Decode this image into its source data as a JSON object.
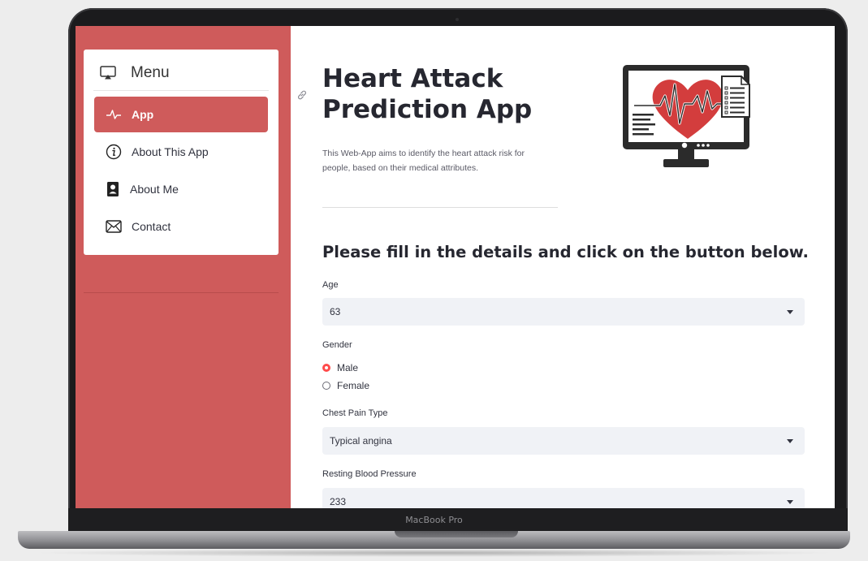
{
  "device": {
    "label": "MacBook Pro"
  },
  "sidebar": {
    "menu_title": "Menu",
    "items": [
      {
        "label": "App",
        "icon": "activity-icon",
        "active": true
      },
      {
        "label": "About This App",
        "icon": "info-icon",
        "active": false
      },
      {
        "label": "About Me",
        "icon": "person-badge-icon",
        "active": false
      },
      {
        "label": "Contact",
        "icon": "envelope-icon",
        "active": false
      }
    ]
  },
  "main": {
    "title": "Heart Attack Prediction App",
    "subtitle": "This Web-App aims to identify the heart attack risk for people, based on their medical attributes.",
    "form_heading": "Please fill in the details and click on the button below.",
    "fields": {
      "age": {
        "label": "Age",
        "value": "63"
      },
      "gender": {
        "label": "Gender",
        "options": [
          "Male",
          "Female"
        ],
        "selected": "Male"
      },
      "chest_pain": {
        "label": "Chest Pain Type",
        "value": "Typical angina"
      },
      "resting_bp": {
        "label": "Resting Blood Pressure",
        "value": "233"
      }
    }
  },
  "colors": {
    "sidebar_bg": "#cf5b5b",
    "accent_red": "#ff4b4b",
    "select_bg": "#f0f2f6",
    "heart_red": "#d33d3d"
  }
}
